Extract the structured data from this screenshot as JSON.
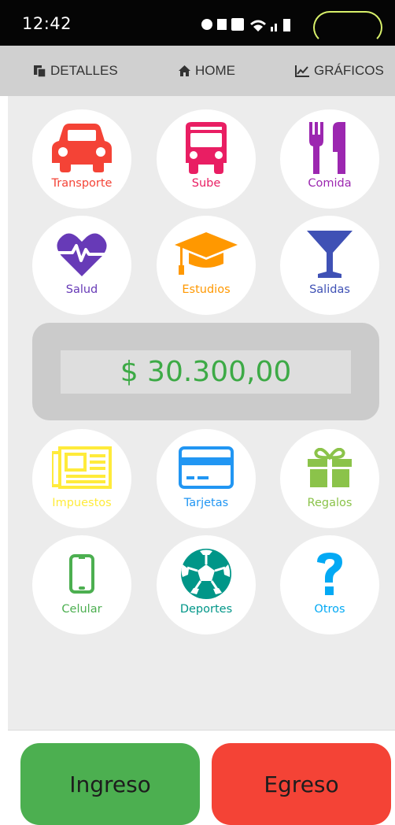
{
  "status_bar": {
    "time": "12:42"
  },
  "nav": {
    "detalles": "DETALLES",
    "home": "HOME",
    "graficos": "GRÁFICOS"
  },
  "categories": [
    {
      "label": "Transporte",
      "icon": "car-icon",
      "color": "#f44336"
    },
    {
      "label": "Sube",
      "icon": "bus-icon",
      "color": "#e91e63"
    },
    {
      "label": "Comida",
      "icon": "utensils-icon",
      "color": "#9c27b0"
    },
    {
      "label": "Salud",
      "icon": "heartbeat-icon",
      "color": "#673ab7"
    },
    {
      "label": "Estudios",
      "icon": "graduation-cap-icon",
      "color": "#ff9800"
    },
    {
      "label": "Salidas",
      "icon": "cocktail-glass-icon",
      "color": "#3f51b5"
    },
    {
      "label": "Impuestos",
      "icon": "newspaper-icon",
      "color": "#ffeb3b"
    },
    {
      "label": "Tarjetas",
      "icon": "credit-card-icon",
      "color": "#2196f3"
    },
    {
      "label": "Regalos",
      "icon": "gift-icon",
      "color": "#8bc34a"
    },
    {
      "label": "Celular",
      "icon": "mobile-phone-icon",
      "color": "#4caf50"
    },
    {
      "label": "Deportes",
      "icon": "soccer-ball-icon",
      "color": "#009688"
    },
    {
      "label": "Otros",
      "icon": "question-mark-icon",
      "color": "#03a9f4"
    }
  ],
  "balance": {
    "amount": "$ 30.300,00",
    "color": "#3daa46"
  },
  "buttons": {
    "ingreso": "Ingreso",
    "egreso": "Egreso"
  }
}
